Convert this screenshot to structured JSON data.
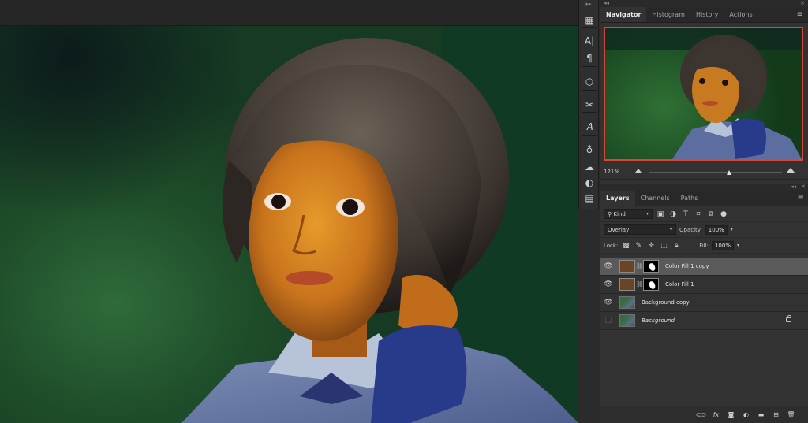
{
  "app": {
    "accent_color": "#d8453a"
  },
  "tools": {
    "items": [
      {
        "name": "grid-icon",
        "glyph": "▦"
      },
      {
        "name": "character-icon",
        "glyph": "A|"
      },
      {
        "name": "paragraph-icon",
        "glyph": "¶"
      },
      {
        "name": "3d-cube-icon",
        "glyph": "⬡"
      },
      {
        "name": "scissors-icon",
        "glyph": "✂"
      },
      {
        "name": "glyphs-icon",
        "glyph": "𝐴"
      },
      {
        "name": "bulb-icon",
        "glyph": "♁"
      },
      {
        "name": "libraries-icon",
        "glyph": "☁"
      },
      {
        "name": "adjustments-icon",
        "glyph": "◐"
      },
      {
        "name": "properties-icon",
        "glyph": "▤"
      }
    ]
  },
  "navigator_panel": {
    "tabs": [
      {
        "label": "Navigator",
        "active": true
      },
      {
        "label": "Histogram",
        "active": false
      },
      {
        "label": "History",
        "active": false
      },
      {
        "label": "Actions",
        "active": false
      }
    ],
    "zoom_label": "121%",
    "zoom_slider_fraction": 0.6
  },
  "layers_panel": {
    "tabs": [
      {
        "label": "Layers",
        "active": true
      },
      {
        "label": "Channels",
        "active": false
      },
      {
        "label": "Paths",
        "active": false
      }
    ],
    "filter_kind": "Kind",
    "blend_mode": "Overlay",
    "opacity_label": "Opacity:",
    "opacity_value": "100%",
    "lock_label": "Lock:",
    "fill_label": "Fill:",
    "fill_value": "100%",
    "layers": [
      {
        "name": "Color Fill 1 copy",
        "type": "fill",
        "visible": true,
        "selected": true,
        "italic": false,
        "locked": false
      },
      {
        "name": "Color Fill 1",
        "type": "fill",
        "visible": true,
        "selected": false,
        "italic": false,
        "locked": false
      },
      {
        "name": "Background copy",
        "type": "photo",
        "visible": true,
        "selected": false,
        "italic": false,
        "locked": false
      },
      {
        "name": "Background",
        "type": "photo",
        "visible": false,
        "selected": false,
        "italic": true,
        "locked": true
      }
    ],
    "fill_swatch_color": "#6b4425"
  }
}
